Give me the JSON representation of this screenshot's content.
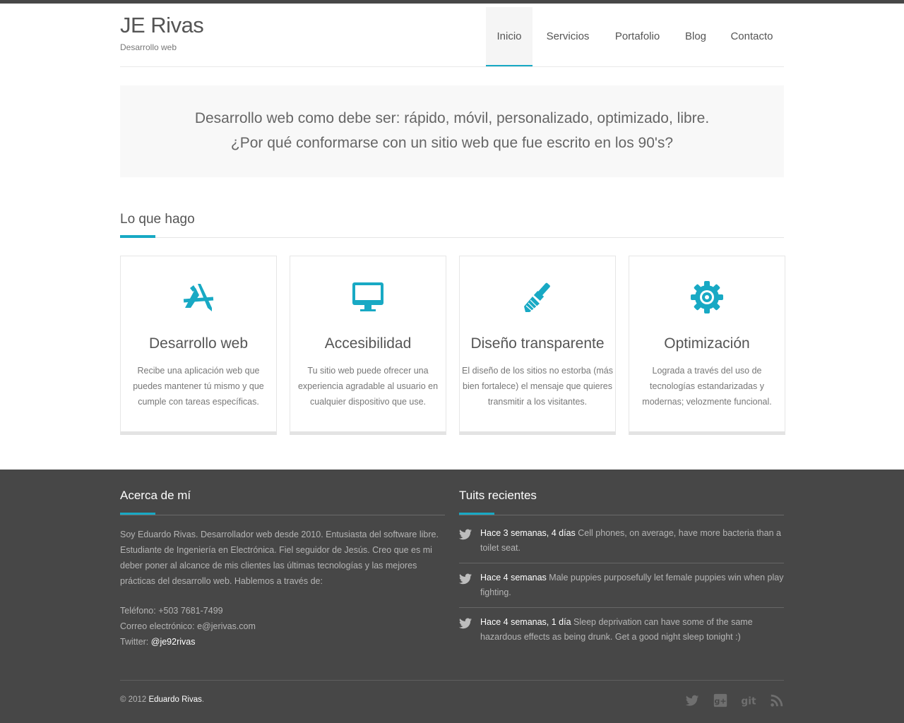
{
  "header": {
    "brand_title": "JE Rivas",
    "brand_subtitle": "Desarrollo web",
    "nav": [
      "Inicio",
      "Servicios",
      "Portafolio",
      "Blog",
      "Contacto"
    ],
    "active_nav": "Inicio"
  },
  "hero": {
    "line1": "Desarrollo web como debe ser: rápido, móvil, personalizado, optimizado, libre.",
    "line2": "¿Por qué conformarse con un sitio web que fue escrito en los 90's?"
  },
  "section": {
    "title": "Lo que hago"
  },
  "services": [
    {
      "icon": "pencil-ruler-icon",
      "title": "Desarrollo web",
      "text": "Recibe una aplicación web que puedes mantener tú mismo y que cumple con tareas específicas."
    },
    {
      "icon": "monitor-icon",
      "title": "Accesibilidad",
      "text": "Tu sitio web puede ofrecer una experiencia agradable al usuario en cualquier dispositivo que use."
    },
    {
      "icon": "paintbrush-icon",
      "title": "Diseño transparente",
      "text": "El diseño de los sitios no estorba (más bien fortalece) el mensaje que quieres transmitir a los visitantes."
    },
    {
      "icon": "gear-icon",
      "title": "Optimización",
      "text": "Lograda a través del uso de tecnologías estandarizadas y modernas; velozmente funcional."
    }
  ],
  "footer": {
    "about_title": "Acerca de mí",
    "about_text": "Soy Eduardo Rivas. Desarrollador web desde 2010. Entusiasta del software libre. Estudiante de Ingeniería en Electrónica. Fiel seguidor de Jesús. Creo que es mi deber poner al alcance de mis clientes las últimas tecnologías y las mejores prácticas del desarrollo web. Hablemos a través de:",
    "phone": "Teléfono: +503 7681-7499",
    "email": "Correo electrónico: e@jerivas.com",
    "twitter_label": "Twitter: ",
    "twitter_handle": "@je92rivas",
    "tweets_title": "Tuits recientes",
    "tweets": [
      {
        "time": "Hace 3 semanas, 4 días",
        "text": "Cell phones, on average, have more bacteria than a toilet seat."
      },
      {
        "time": "Hace 4 semanas",
        "text": "Male puppies purposefully let female puppies win when play fighting."
      },
      {
        "time": "Hace 4 semanas, 1 día",
        "text": "Sleep deprivation can have some of the same hazardous effects as being drunk. Get a good night sleep tonight :)"
      }
    ],
    "copyright_prefix": "© 2012 ",
    "copyright_name": "Eduardo Rivas",
    "copyright_suffix": ".",
    "social": [
      "twitter-icon",
      "google-plus-icon",
      "git-icon",
      "rss-icon"
    ]
  },
  "colors": {
    "accent": "#18a9c4",
    "footer_bg": "#474747",
    "hero_bg": "#f8f8f8"
  }
}
